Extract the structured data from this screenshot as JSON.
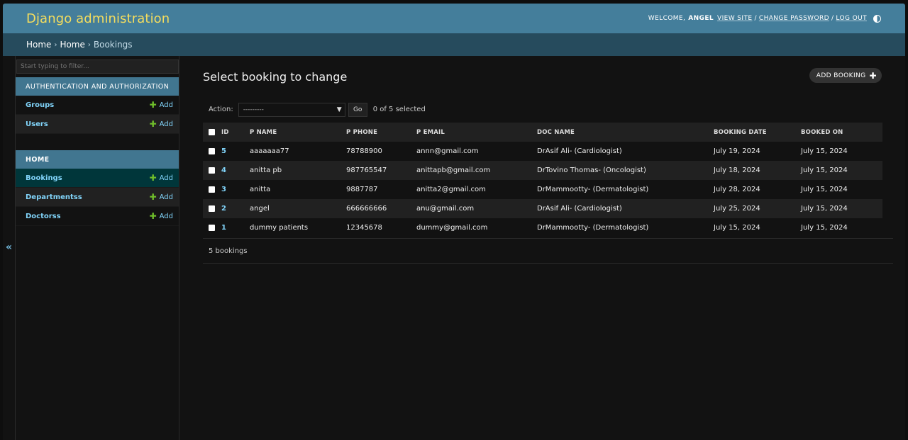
{
  "header": {
    "site_name": "Django administration",
    "welcome_label": "WELCOME,",
    "username": "ANGEL",
    "view_site": "VIEW SITE",
    "separator": "/",
    "change_password": "CHANGE PASSWORD",
    "log_out": "LOG OUT"
  },
  "breadcrumbs": {
    "items": [
      "Home",
      "Home",
      "Bookings"
    ],
    "separator": "›"
  },
  "sidebar": {
    "filter_placeholder": "Start typing to filter...",
    "toggle_glyph": "«",
    "modules": [
      {
        "caption": "AUTHENTICATION AND AUTHORIZATION",
        "models": [
          {
            "name": "Groups",
            "add_label": "Add"
          },
          {
            "name": "Users",
            "add_label": "Add"
          }
        ]
      },
      {
        "caption": "HOME",
        "models": [
          {
            "name": "Bookings",
            "add_label": "Add",
            "current": true
          },
          {
            "name": "Departmentss",
            "add_label": "Add"
          },
          {
            "name": "Doctorss",
            "add_label": "Add"
          }
        ]
      }
    ]
  },
  "content": {
    "title": "Select booking to change",
    "add_button": "ADD BOOKING",
    "action_label": "Action:",
    "action_selected": "---------",
    "go_label": "Go",
    "selection_count": "0 of 5 selected",
    "columns": [
      "ID",
      "P NAME",
      "P PHONE",
      "P EMAIL",
      "DOC NAME",
      "BOOKING DATE",
      "BOOKED ON"
    ],
    "rows": [
      {
        "id": "5",
        "p_name": "aaaaaaa77",
        "p_phone": "78788900",
        "p_email": "annn@gmail.com",
        "doc_name": "DrAsif Ali- (Cardiologist)",
        "booking_date": "July 19, 2024",
        "booked_on": "July 15, 2024"
      },
      {
        "id": "4",
        "p_name": "anitta pb",
        "p_phone": "987765547",
        "p_email": "anittapb@gmail.com",
        "doc_name": "DrTovino Thomas- (Oncologist)",
        "booking_date": "July 18, 2024",
        "booked_on": "July 15, 2024"
      },
      {
        "id": "3",
        "p_name": "anitta",
        "p_phone": "9887787",
        "p_email": "anitta2@gmail.com",
        "doc_name": "DrMammootty- (Dermatologist)",
        "booking_date": "July 28, 2024",
        "booked_on": "July 15, 2024"
      },
      {
        "id": "2",
        "p_name": "angel",
        "p_phone": "666666666",
        "p_email": "anu@gmail.com",
        "doc_name": "DrAsif Ali- (Cardiologist)",
        "booking_date": "July 25, 2024",
        "booked_on": "July 15, 2024"
      },
      {
        "id": "1",
        "p_name": "dummy patients",
        "p_phone": "12345678",
        "p_email": "dummy@gmail.com",
        "doc_name": "DrMammootty- (Dermatologist)",
        "booking_date": "July 15, 2024",
        "booked_on": "July 15, 2024"
      }
    ],
    "result_count": "5 bookings"
  },
  "colors": {
    "header_bg": "#447e9b",
    "branding": "#f5dd5d",
    "breadcrumbs_bg": "#264b5d",
    "module_caption_bg": "#417690",
    "link": "#81d4fa",
    "add_icon": "#70bf2b",
    "page_bg": "#121212"
  }
}
